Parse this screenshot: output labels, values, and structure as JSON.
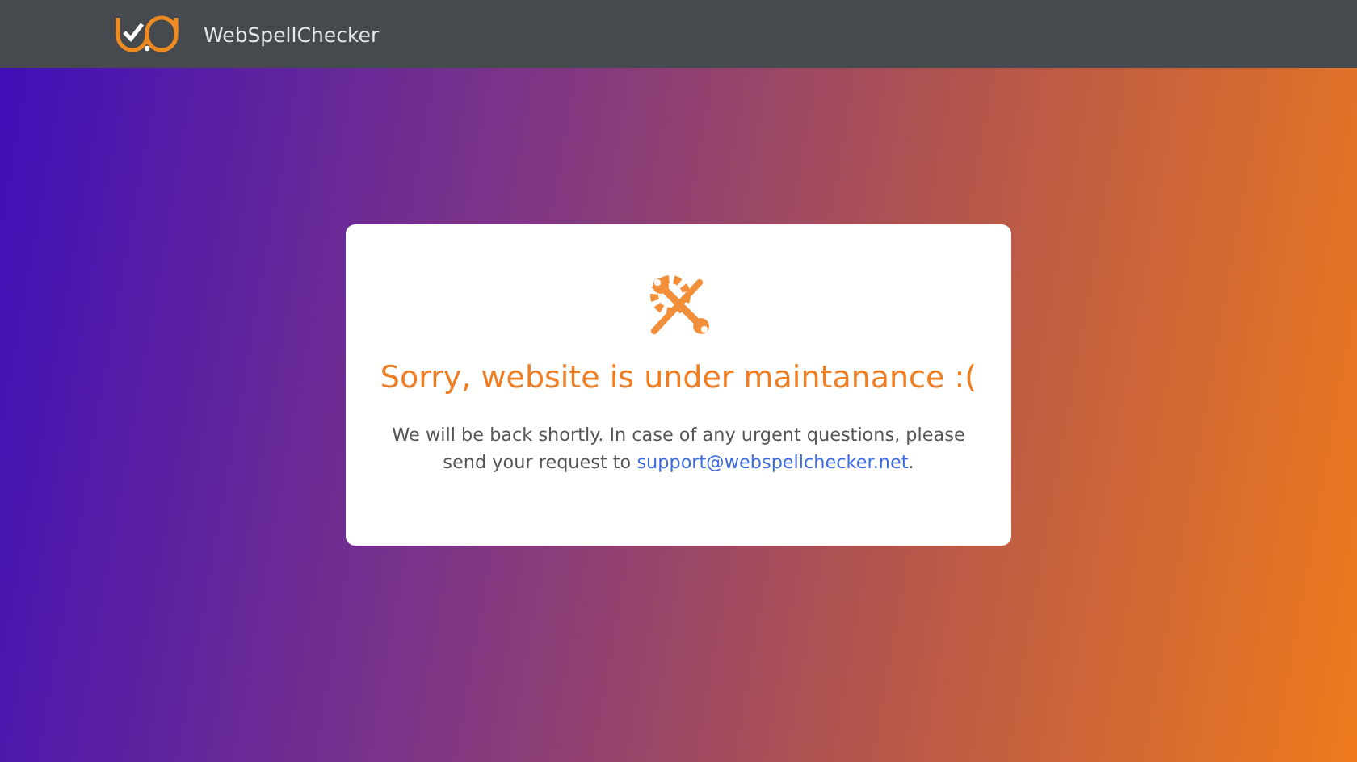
{
  "header": {
    "brand": "WebSpellChecker"
  },
  "notice": {
    "title": "Sorry, website is under maintanance :(",
    "message_before": "We will be back shortly. In case of any urgent questions, please send your request to ",
    "link": "support@webspellchecker.net",
    "message_after": "."
  }
}
